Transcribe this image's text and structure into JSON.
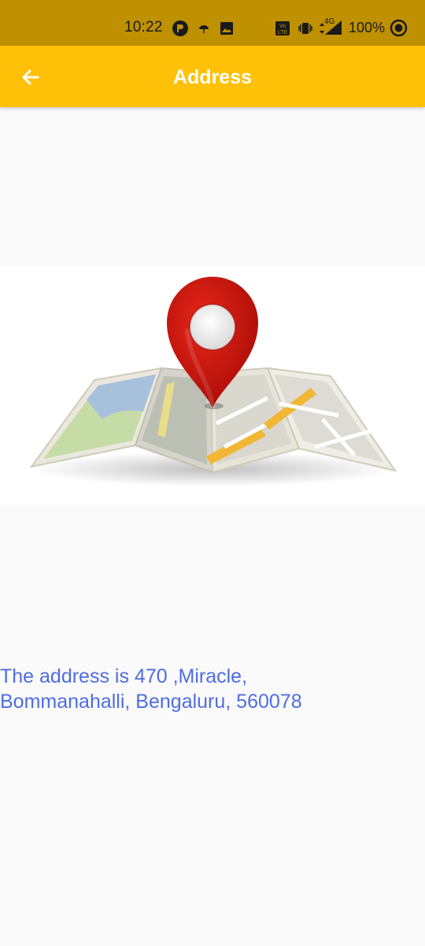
{
  "status_bar": {
    "time": "10:22",
    "battery": "100%",
    "network": "4G",
    "icons": [
      "app-notification-icon",
      "umbrella-icon",
      "image-icon",
      "volte-icon",
      "vibrate-icon",
      "signal-icon",
      "data-saver-icon"
    ]
  },
  "app_bar": {
    "title": "Address",
    "back_icon": "arrow-back-icon",
    "color": "#ffc107"
  },
  "main": {
    "map_image": "map-pin-illustration",
    "address_line1": "The address is 470 ,Miracle,",
    "address_line2": "Bommanahalli, Bengaluru, 560078",
    "address_color": "#4e6de3"
  }
}
